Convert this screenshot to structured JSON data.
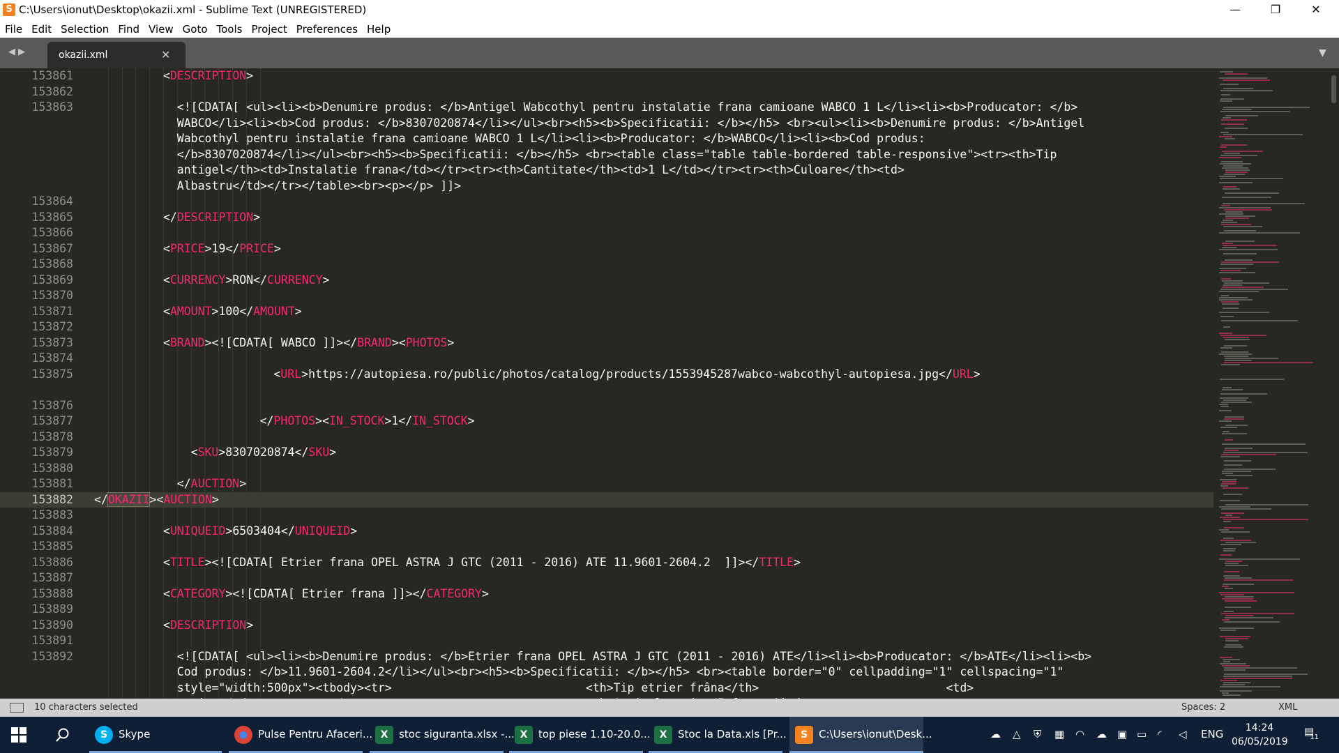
{
  "window": {
    "title": "C:\\Users\\ionut\\Desktop\\okazii.xml - Sublime Text (UNREGISTERED)",
    "app_icon": "S",
    "controls": {
      "minimize": "—",
      "maximize": "❐",
      "close": "✕"
    }
  },
  "menu": [
    "File",
    "Edit",
    "Selection",
    "Find",
    "View",
    "Goto",
    "Tools",
    "Project",
    "Preferences",
    "Help"
  ],
  "tabs": {
    "nav_arrows": "◀ ▶",
    "active": {
      "label": "okazii.xml",
      "close": "✕"
    },
    "menu_arrow": "▼"
  },
  "editor": {
    "lines": [
      {
        "n": "153861",
        "indent": 5,
        "segs": [
          [
            "p",
            "<"
          ],
          [
            "t",
            "DESCRIPTION"
          ],
          [
            "p",
            ">"
          ]
        ]
      },
      {
        "n": "153862",
        "indent": 0,
        "segs": []
      },
      {
        "n": "153863",
        "indent": 6,
        "segs": [
          [
            "p",
            "<![CDATA[ <ul><li><b>Denumire produs: </b>Antigel Wabcothyl pentru instalatie frana camioane WABCO 1 L</li><li><b>Producator: </b>"
          ]
        ]
      },
      {
        "n": "",
        "indent": 6,
        "segs": [
          [
            "p",
            "WABCO</li><li><b>Cod produs: </b>8307020874</li></ul><br><h5><b>Specificatii: </b></h5> <br><ul><li><b>Denumire produs: </b>Antigel"
          ]
        ]
      },
      {
        "n": "",
        "indent": 6,
        "segs": [
          [
            "p",
            "Wabcothyl pentru instalatie frana camioane WABCO 1 L</li><li><b>Producator: </b>WABCO</li><li><b>Cod produs:"
          ]
        ]
      },
      {
        "n": "",
        "indent": 6,
        "segs": [
          [
            "p",
            "</b>8307020874</li></ul><br><h5><b>Specificatii: </b></h5> <br><table class=\"table table-bordered table-responsive\"><tr><th>Tip"
          ]
        ]
      },
      {
        "n": "",
        "indent": 6,
        "segs": [
          [
            "p",
            "antigel</th><td>Instalatie frana</td></tr><tr><th>Cantitate</th><td>1 L</td></tr><tr><th>Culoare</th><td>"
          ]
        ]
      },
      {
        "n": "",
        "indent": 6,
        "segs": [
          [
            "p",
            "Albastru</td></tr></table><br><p></p> ]]>"
          ]
        ]
      },
      {
        "n": "153864",
        "indent": 0,
        "segs": []
      },
      {
        "n": "153865",
        "indent": 5,
        "segs": [
          [
            "p",
            "</"
          ],
          [
            "t",
            "DESCRIPTION"
          ],
          [
            "p",
            ">"
          ]
        ]
      },
      {
        "n": "153866",
        "indent": 0,
        "segs": []
      },
      {
        "n": "153867",
        "indent": 5,
        "segs": [
          [
            "p",
            "<"
          ],
          [
            "t",
            "PRICE"
          ],
          [
            "p",
            ">19</"
          ],
          [
            "t",
            "PRICE"
          ],
          [
            "p",
            ">"
          ]
        ]
      },
      {
        "n": "153868",
        "indent": 0,
        "segs": []
      },
      {
        "n": "153869",
        "indent": 5,
        "segs": [
          [
            "p",
            "<"
          ],
          [
            "t",
            "CURRENCY"
          ],
          [
            "p",
            ">RON</"
          ],
          [
            "t",
            "CURRENCY"
          ],
          [
            "p",
            ">"
          ]
        ]
      },
      {
        "n": "153870",
        "indent": 0,
        "segs": []
      },
      {
        "n": "153871",
        "indent": 5,
        "segs": [
          [
            "p",
            "<"
          ],
          [
            "t",
            "AMOUNT"
          ],
          [
            "p",
            ">100</"
          ],
          [
            "t",
            "AMOUNT"
          ],
          [
            "p",
            ">"
          ]
        ]
      },
      {
        "n": "153872",
        "indent": 0,
        "segs": []
      },
      {
        "n": "153873",
        "indent": 5,
        "segs": [
          [
            "p",
            "<"
          ],
          [
            "t",
            "BRAND"
          ],
          [
            "p",
            "><![CDATA[ WABCO ]]></"
          ],
          [
            "t",
            "BRAND"
          ],
          [
            "p",
            "><"
          ],
          [
            "t",
            "PHOTOS"
          ],
          [
            "p",
            ">"
          ]
        ]
      },
      {
        "n": "153874",
        "indent": 0,
        "segs": []
      },
      {
        "n": "153875",
        "indent": 13,
        "segs": [
          [
            "p",
            "<"
          ],
          [
            "t",
            "URL"
          ],
          [
            "p",
            ">https://autopiesa.ro/public/photos/catalog/products/1553945287wabco-wabcothyl-autopiesa.jpg</"
          ],
          [
            "t",
            "URL"
          ],
          [
            "p",
            ">"
          ]
        ]
      },
      {
        "n": "",
        "indent": 0,
        "segs": []
      },
      {
        "n": "153876",
        "indent": 0,
        "segs": []
      },
      {
        "n": "153877",
        "indent": 12,
        "segs": [
          [
            "p",
            "</"
          ],
          [
            "t",
            "PHOTOS"
          ],
          [
            "p",
            "><"
          ],
          [
            "t",
            "IN_STOCK"
          ],
          [
            "p",
            ">1</"
          ],
          [
            "t",
            "IN_STOCK"
          ],
          [
            "p",
            ">"
          ]
        ]
      },
      {
        "n": "153878",
        "indent": 0,
        "segs": []
      },
      {
        "n": "153879",
        "indent": 7,
        "segs": [
          [
            "p",
            "<"
          ],
          [
            "t",
            "SKU"
          ],
          [
            "p",
            ">8307020874</"
          ],
          [
            "t",
            "SKU"
          ],
          [
            "p",
            ">"
          ]
        ]
      },
      {
        "n": "153880",
        "indent": 0,
        "segs": []
      },
      {
        "n": "153881",
        "indent": 6,
        "segs": [
          [
            "p",
            "</"
          ],
          [
            "t",
            "AUCTION"
          ],
          [
            "p",
            ">"
          ]
        ]
      },
      {
        "n": "153882",
        "indent": 0,
        "active": true,
        "segs": [
          [
            "p",
            "</"
          ],
          [
            "s",
            "OKAZII"
          ],
          [
            "p",
            "><"
          ],
          [
            "t",
            "AUCTION"
          ],
          [
            "p",
            ">"
          ]
        ]
      },
      {
        "n": "153883",
        "indent": 0,
        "segs": []
      },
      {
        "n": "153884",
        "indent": 5,
        "segs": [
          [
            "p",
            "<"
          ],
          [
            "t",
            "UNIQUEID"
          ],
          [
            "p",
            ">6503404</"
          ],
          [
            "t",
            "UNIQUEID"
          ],
          [
            "p",
            ">"
          ]
        ]
      },
      {
        "n": "153885",
        "indent": 0,
        "segs": []
      },
      {
        "n": "153886",
        "indent": 5,
        "segs": [
          [
            "p",
            "<"
          ],
          [
            "t",
            "TITLE"
          ],
          [
            "p",
            "><![CDATA[ Etrier frana OPEL ASTRA J GTC (2011 - 2016) ATE 11.9601-2604.2  ]]></"
          ],
          [
            "t",
            "TITLE"
          ],
          [
            "p",
            ">"
          ]
        ]
      },
      {
        "n": "153887",
        "indent": 0,
        "segs": []
      },
      {
        "n": "153888",
        "indent": 5,
        "segs": [
          [
            "p",
            "<"
          ],
          [
            "t",
            "CATEGORY"
          ],
          [
            "p",
            "><![CDATA[ Etrier frana ]]></"
          ],
          [
            "t",
            "CATEGORY"
          ],
          [
            "p",
            ">"
          ]
        ]
      },
      {
        "n": "153889",
        "indent": 0,
        "segs": []
      },
      {
        "n": "153890",
        "indent": 5,
        "segs": [
          [
            "p",
            "<"
          ],
          [
            "t",
            "DESCRIPTION"
          ],
          [
            "p",
            ">"
          ]
        ]
      },
      {
        "n": "153891",
        "indent": 0,
        "segs": []
      },
      {
        "n": "153892",
        "indent": 6,
        "segs": [
          [
            "p",
            "<![CDATA[ <ul><li><b>Denumire produs: </b>Etrier frana OPEL ASTRA J GTC (2011 - 2016) ATE</li><li><b>Producator: </b>ATE</li><li><b>"
          ]
        ]
      },
      {
        "n": "",
        "indent": 6,
        "segs": [
          [
            "p",
            "Cod produs: </b>11.9601-2604.2</li></ul><br><h5><b>Specificatii: </b></h5> <br><table border=\"0\" cellpadding=\"1\" cellspacing=\"1\""
          ]
        ]
      },
      {
        "n": "",
        "indent": 6,
        "segs": [
          [
            "p",
            "style=\"width:500px\"><tbody><tr>                            <th>Tip etrier frâna</th>                           <td>"
          ]
        ]
      },
      {
        "n": "",
        "indent": 6,
        "segs": [
          [
            "p",
            "etrier</td>           </tr><tr>                            <th>Articol extins/Informatii de"
          ]
        ]
      }
    ]
  },
  "status": {
    "selection": "10 characters selected",
    "spaces": "Spaces: 2",
    "syntax": "XML"
  },
  "taskbar": {
    "apps": [
      {
        "label": "Skype",
        "icon": "skype-icon",
        "color": "#00aff0",
        "glyph": "S"
      },
      {
        "label": "Pulse Pentru Afaceri...",
        "icon": "chrome-icon",
        "color": "#db4437",
        "glyph": "●"
      },
      {
        "label": "stoc siguranta.xlsx -...",
        "icon": "excel-icon",
        "color": "#1d7044",
        "glyph": "X"
      },
      {
        "label": "top piese 1.10-20.0...",
        "icon": "excel-icon",
        "color": "#1d7044",
        "glyph": "X"
      },
      {
        "label": "Stoc la Data.xls  [Pr...",
        "icon": "excel-icon",
        "color": "#1d7044",
        "glyph": "X"
      },
      {
        "label": "C:\\Users\\ionut\\Desk...",
        "icon": "sublime-icon",
        "color": "#f48220",
        "glyph": "S"
      }
    ],
    "language": "ENG",
    "time": "14:24",
    "date": "06/05/2019",
    "notifications": "11"
  }
}
